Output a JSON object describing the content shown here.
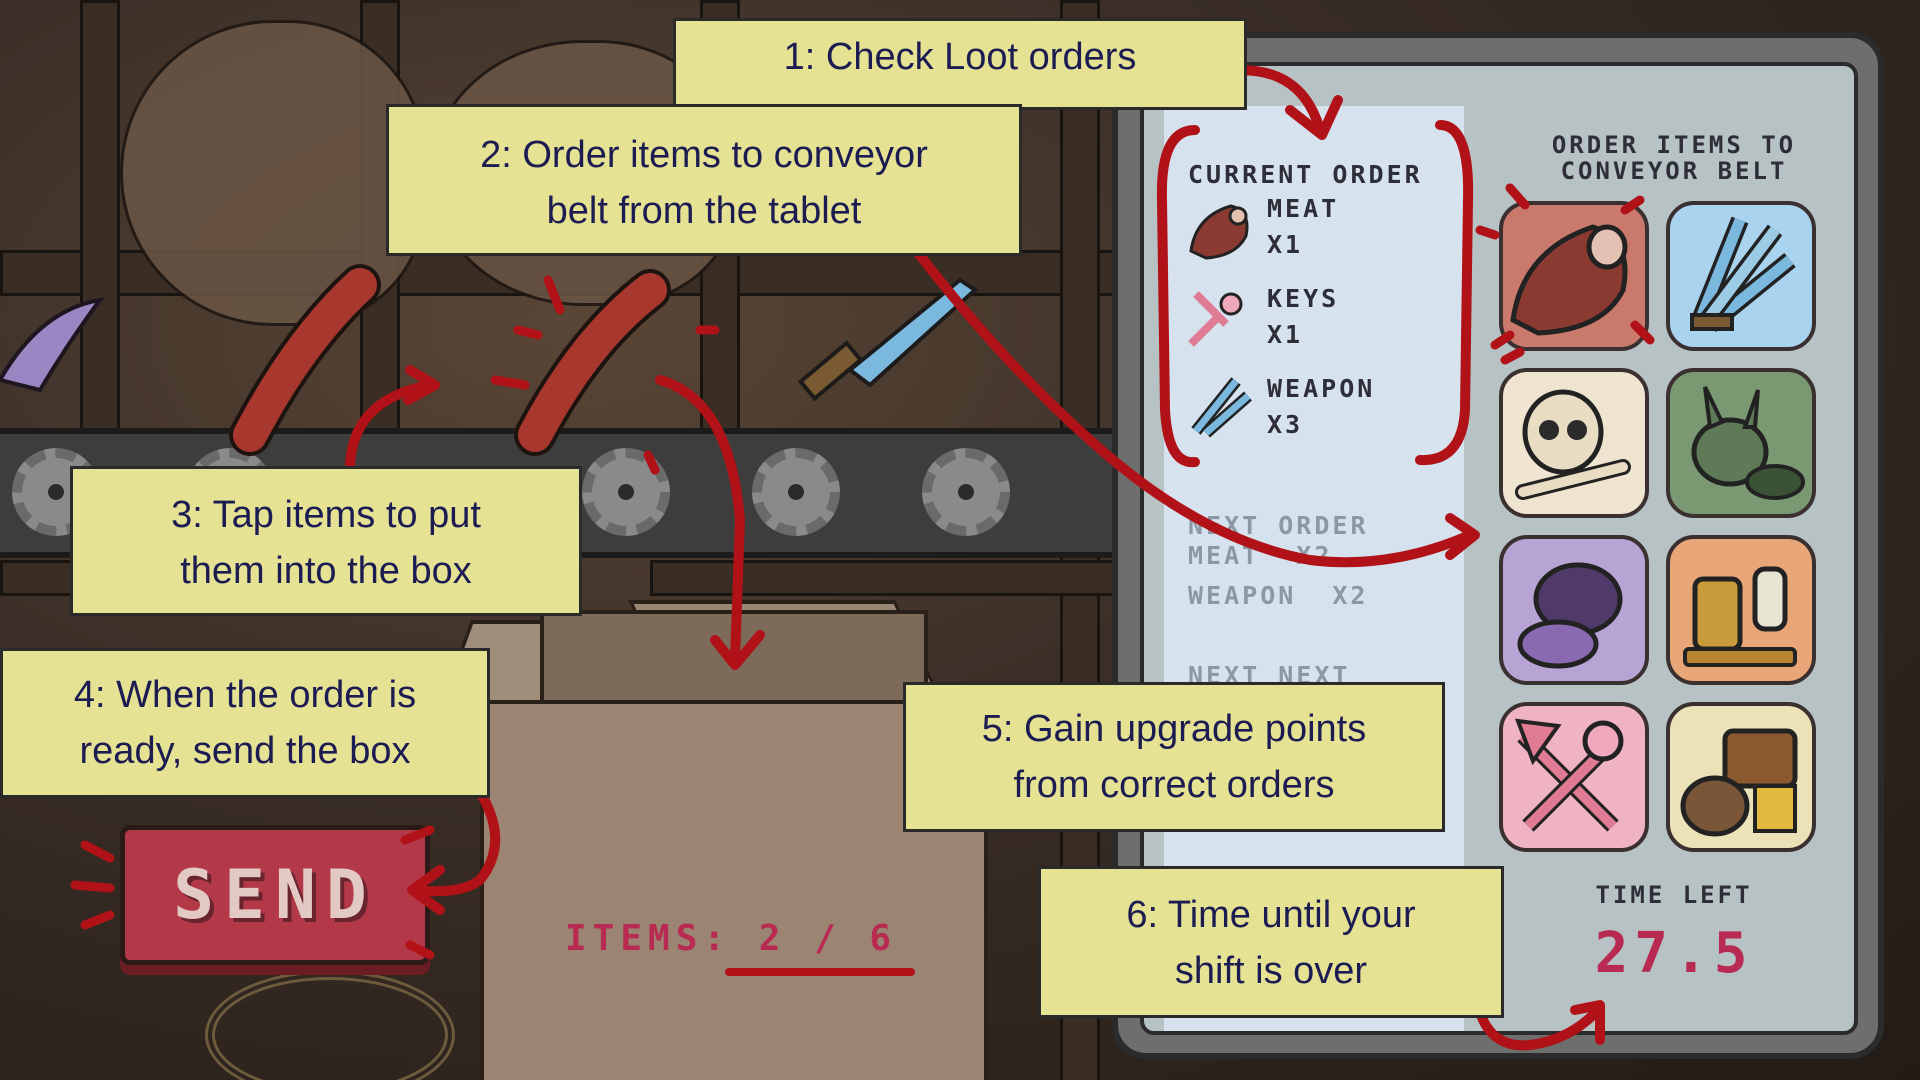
{
  "callouts": {
    "step1": "1: Check Loot orders",
    "step2_line1": "2: Order items to conveyor",
    "step2_line2": "belt from the tablet",
    "step3_line1": "3: Tap items to put",
    "step3_line2": "them into the box",
    "step4_line1": "4: When the order is",
    "step4_line2": "ready, send the box",
    "step5_line1": "5: Gain upgrade points",
    "step5_line2": "from correct orders",
    "step6_line1": "6: Time until your",
    "step6_line2": "shift is over"
  },
  "tablet": {
    "current_order_title": "CURRENT ORDER",
    "current_order": [
      {
        "name": "MEAT",
        "qty": "X1",
        "icon": "meat-icon"
      },
      {
        "name": "KEYS",
        "qty": "X1",
        "icon": "keys-icon"
      },
      {
        "name": "WEAPON",
        "qty": "X3",
        "icon": "weapon-icon"
      }
    ],
    "next_order_title": "NEXT ORDER",
    "next_order": [
      {
        "name": "MEAT",
        "qty": "X2"
      },
      {
        "name": "WEAPON",
        "qty": "X2"
      }
    ],
    "next_next_title": "NEXT NEXT",
    "grid_title_line1": "ORDER ITEMS TO",
    "grid_title_line2": "CONVEYOR BELT",
    "items": [
      {
        "icon": "meat-icon",
        "bg": "#c97a6c"
      },
      {
        "icon": "swords-icon",
        "bg": "#a9d3ee"
      },
      {
        "icon": "skull-icon",
        "bg": "#efe4cf"
      },
      {
        "icon": "zombie-bunny-icon",
        "bg": "#7a9872"
      },
      {
        "icon": "creature-icon",
        "bg": "#b7a3d4"
      },
      {
        "icon": "lantern-icon",
        "bg": "#e8a679"
      },
      {
        "icon": "keys-icon",
        "bg": "#efb3c4"
      },
      {
        "icon": "treasure-icon",
        "bg": "#ece2b8"
      }
    ],
    "time_left_label": "TIME LEFT",
    "time_left_value": "27.5"
  },
  "game": {
    "send_label": "SEND",
    "items_count": "ITEMS: 2 / 6"
  },
  "colors": {
    "callout_bg": "#e6e294",
    "callout_text": "#1c1c52",
    "arrow_red": "#b01218",
    "accent_pink": "#b82a52"
  }
}
